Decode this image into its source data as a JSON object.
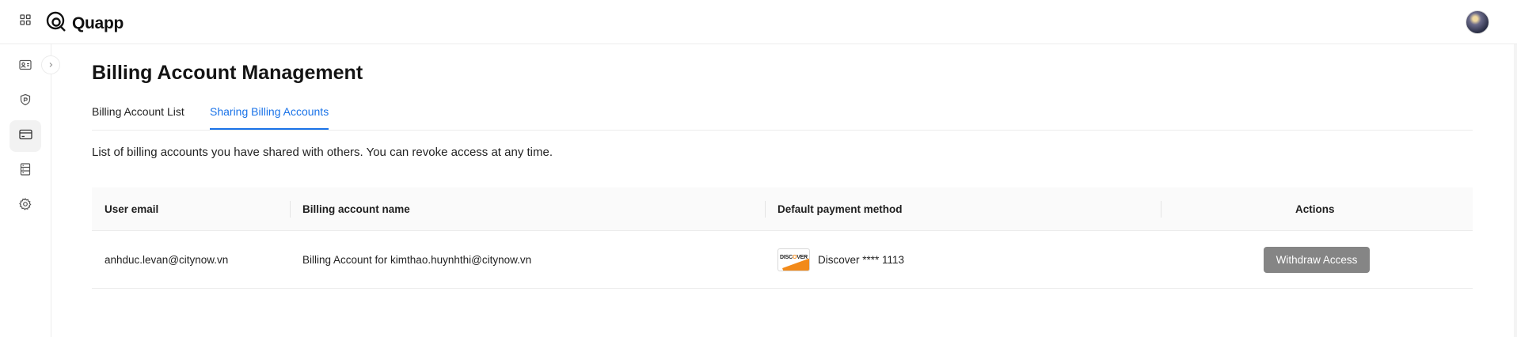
{
  "app": {
    "name": "Quapp"
  },
  "icons": {
    "apps": "grid-icon",
    "logo": "quapp-logo-icon",
    "sidebar": [
      "id-card-icon",
      "shield-icon",
      "credit-card-icon",
      "server-icon",
      "gear-icon"
    ],
    "collapse": "chevron-right-icon"
  },
  "colors": {
    "accent": "#1a73e8",
    "button_bg": "#858585",
    "discover_orange": "#f28a1a"
  },
  "page": {
    "title": "Billing Account Management",
    "tabs": [
      {
        "label": "Billing Account List",
        "active": false
      },
      {
        "label": "Sharing Billing Accounts",
        "active": true
      }
    ],
    "description": "List of billing accounts you have shared with others. You can revoke access at any time."
  },
  "table": {
    "columns": [
      "User email",
      "Billing account name",
      "Default payment method",
      "Actions"
    ],
    "rows": [
      {
        "user_email": "anhduc.levan@citynow.vn",
        "billing_account_name": "Billing Account for kimthao.huynhthi@citynow.vn",
        "payment_method": {
          "brand_logo": "DISCOVER",
          "label": "Discover **** 1113"
        },
        "action_label": "Withdraw Access"
      }
    ]
  }
}
